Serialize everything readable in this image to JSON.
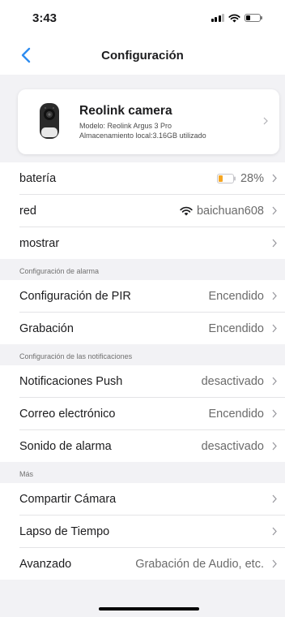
{
  "status": {
    "time": "3:43"
  },
  "nav": {
    "title": "Configuración"
  },
  "device": {
    "name": "Reolink camera",
    "model": "Modelo: Reolink Argus 3 Pro",
    "storage": "Almacenamiento local:3.16GB utilizado"
  },
  "main": {
    "battery": {
      "label": "batería",
      "value": "28%",
      "level": 0.28,
      "color": "#f5a623"
    },
    "network": {
      "label": "red",
      "value": "baichuan608"
    },
    "display": {
      "label": "mostrar"
    }
  },
  "alarm": {
    "header": "Configuración de alarma",
    "pir": {
      "label": "Configuración de PIR",
      "value": "Encendido"
    },
    "recording": {
      "label": "Grabación",
      "value": "Encendido"
    }
  },
  "notifications": {
    "header": "Configuración de las notificaciones",
    "push": {
      "label": "Notificaciones Push",
      "value": "desactivado"
    },
    "email": {
      "label": "Correo electrónico",
      "value": "Encendido"
    },
    "sound": {
      "label": "Sonido de alarma",
      "value": "desactivado"
    }
  },
  "more": {
    "header": "Más",
    "share": {
      "label": "Compartir Cámara"
    },
    "timelapse": {
      "label": "Lapso de Tiempo"
    },
    "advanced": {
      "label": "Avanzado",
      "value": "Grabación de Audio, etc."
    }
  },
  "colors": {
    "accent": "#2e8cf0",
    "battery_low": "#f5a623"
  },
  "icons": [
    "back-chevron-icon",
    "chevron-right-icon",
    "wifi-icon",
    "battery-icon",
    "camera-icon"
  ]
}
